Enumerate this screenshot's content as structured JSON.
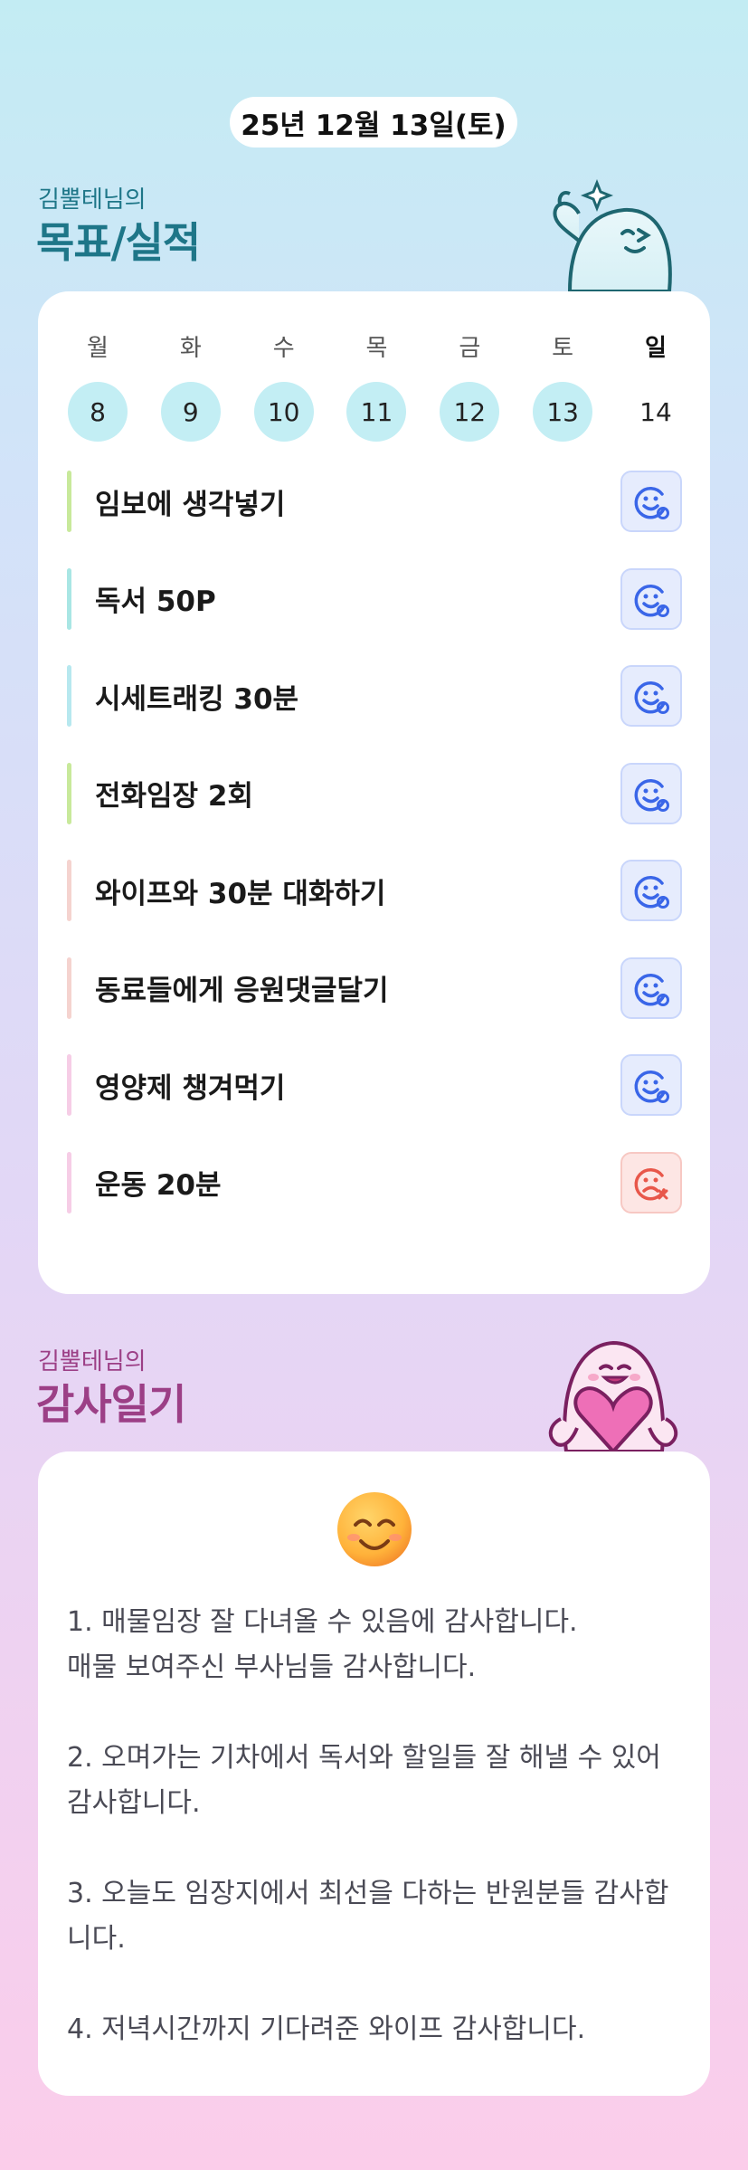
{
  "header": {
    "date": "25년 12월 13일(토)"
  },
  "goals_section": {
    "subtitle": "김뿔테님의",
    "title": "목표/실적",
    "week": [
      {
        "day": "월",
        "date": "8",
        "highlight": true
      },
      {
        "day": "화",
        "date": "9",
        "highlight": true
      },
      {
        "day": "수",
        "date": "10",
        "highlight": true
      },
      {
        "day": "목",
        "date": "11",
        "highlight": true
      },
      {
        "day": "금",
        "date": "12",
        "highlight": true
      },
      {
        "day": "토",
        "date": "13",
        "highlight": true
      },
      {
        "day": "일",
        "date": "14",
        "highlight": false
      }
    ],
    "goals": [
      {
        "label": "임보에 생각넣기",
        "color": "#c8e99b",
        "status": "done"
      },
      {
        "label": "독서 50P",
        "color": "#a9e6e4",
        "status": "done"
      },
      {
        "label": "시세트래킹 30분",
        "color": "#b7e8ef",
        "status": "done"
      },
      {
        "label": "전화임장 2회",
        "color": "#c8e99b",
        "status": "done"
      },
      {
        "label": "와이프와 30분 대화하기",
        "color": "#f5d3cf",
        "status": "done"
      },
      {
        "label": "동료들에게 응원댓글달기",
        "color": "#f5d3cf",
        "status": "done"
      },
      {
        "label": "영양제 챙겨먹기",
        "color": "#f6cde6",
        "status": "done"
      },
      {
        "label": "운동 20분",
        "color": "#f6cde6",
        "status": "failed"
      }
    ]
  },
  "diary_section": {
    "subtitle": "김뿔테님의",
    "title": "감사일기",
    "mood_icon": "smiling-face-icon",
    "entries": [
      "1. 매물임장 잘 다녀올 수 있음에 감사합니다.\n매물 보여주신 부사님들 감사합니다.",
      "2. 오며가는 기차에서 독서와 할일들 잘 해낼 수 있어 감사합니다.",
      "3. 오늘도 임장지에서 최선을 다하는 반원분들 감사합니다.",
      "4. 저녁시간까지 기다려준 와이프 감사합니다."
    ]
  },
  "colors": {
    "teal_title": "#1e7688",
    "plum_title": "#9c3f86",
    "status_ok": "#3a66e8",
    "status_fail": "#e8574a"
  }
}
